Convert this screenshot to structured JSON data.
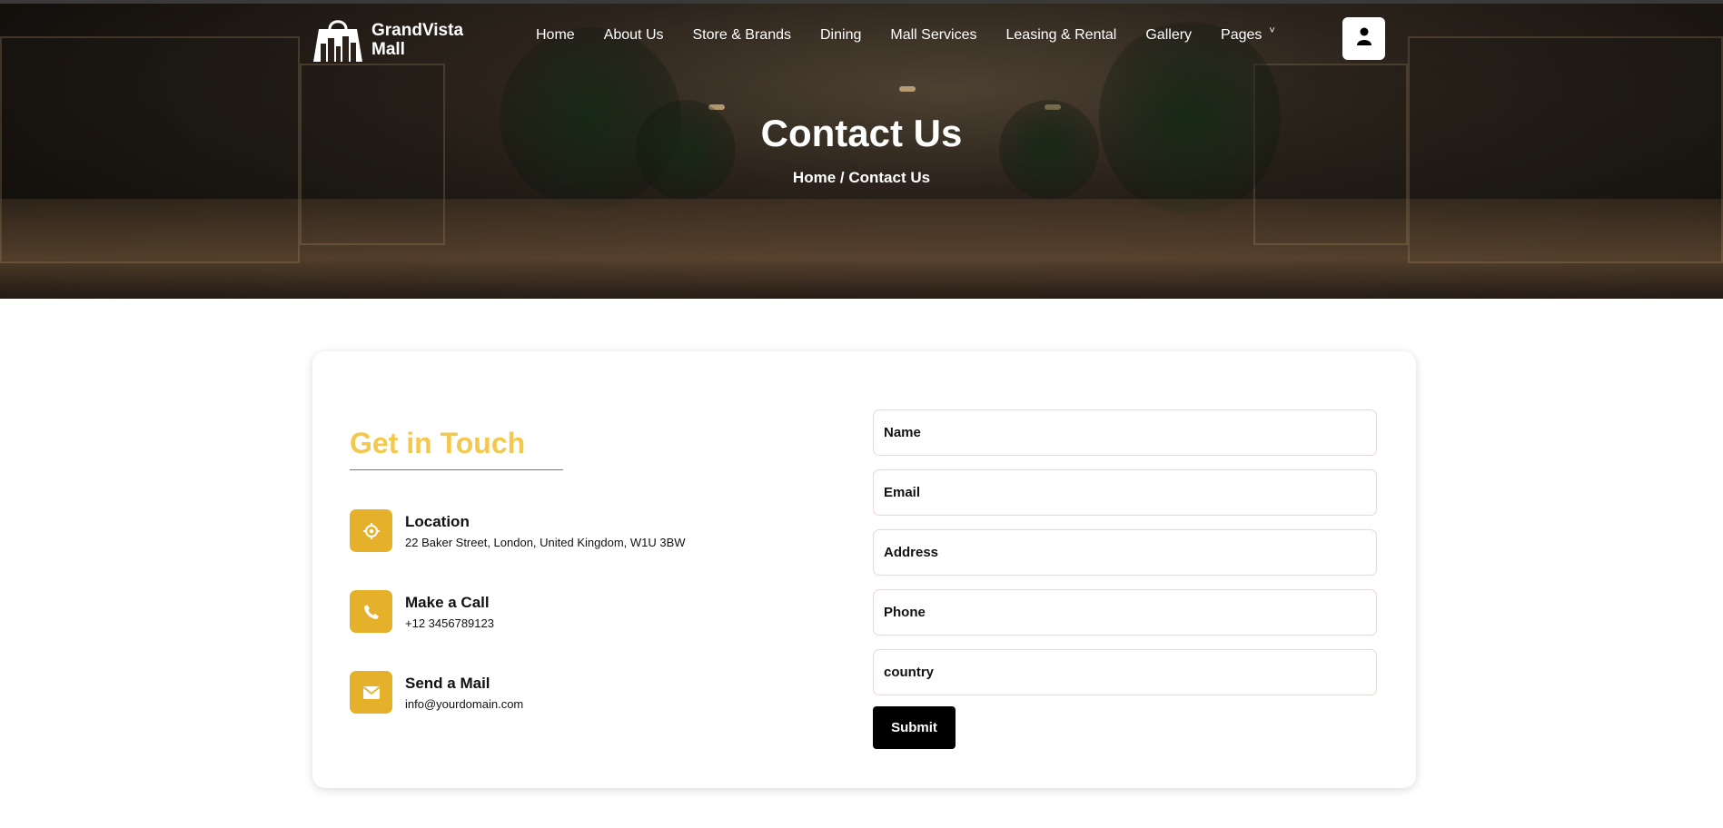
{
  "brand": {
    "name_line1": "GrandVista",
    "name_line2": "Mall",
    "logo_icon": "shopping-bag-skyline-icon"
  },
  "nav": {
    "items": [
      {
        "label": "Home"
      },
      {
        "label": "About Us"
      },
      {
        "label": "Store & Brands"
      },
      {
        "label": "Dining"
      },
      {
        "label": "Mall Services"
      },
      {
        "label": "Leasing & Rental"
      },
      {
        "label": "Gallery"
      },
      {
        "label": "Pages"
      }
    ],
    "caret": "˅",
    "user_icon": "user-icon"
  },
  "hero": {
    "title": "Contact Us",
    "breadcrumb_home": "Home",
    "breadcrumb_sep": " / ",
    "breadcrumb_current": "Contact Us"
  },
  "contact": {
    "heading": "Get in Touch",
    "accent_color": "#f2c94c",
    "icon_bg_color": "#e5b12b",
    "items": [
      {
        "icon": "location-target-icon",
        "title": "Location",
        "value": "22 Baker Street, London, United Kingdom, W1U 3BW"
      },
      {
        "icon": "phone-icon",
        "title": "Make a Call",
        "value": "+12 3456789123"
      },
      {
        "icon": "envelope-icon",
        "title": "Send a Mail",
        "value": "info@yourdomain.com"
      }
    ]
  },
  "form": {
    "name_placeholder": "Name",
    "email_placeholder": "Email",
    "address_placeholder": "Address",
    "phone_placeholder": "Phone",
    "country_placeholder": "country",
    "submit_label": "Submit"
  }
}
